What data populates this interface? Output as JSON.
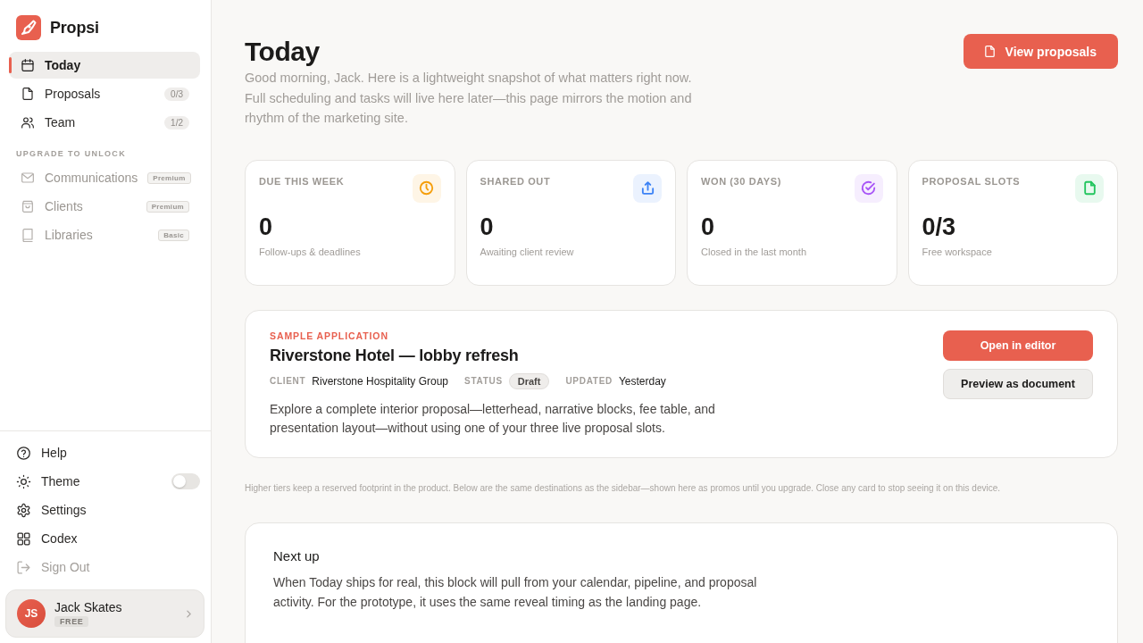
{
  "brand": {
    "name": "Propsi"
  },
  "sidebar": {
    "items": [
      {
        "label": "Today",
        "selected": true
      },
      {
        "label": "Proposals",
        "selected": false,
        "count": "0/3"
      },
      {
        "label": "Team",
        "selected": false,
        "count": "1/2"
      }
    ],
    "upgrade_section": {
      "title": "UPGRADE TO UNLOCK",
      "items": [
        {
          "label": "Communications",
          "badge": "Premium",
          "disabled": true
        },
        {
          "label": "Clients",
          "badge": "Premium",
          "disabled": true
        },
        {
          "label": "Libraries",
          "badge": "Basic",
          "disabled": true
        }
      ]
    },
    "footer_items": [
      {
        "label": "Help",
        "kind": "link"
      },
      {
        "label": "Theme",
        "kind": "toggle",
        "on": false
      },
      {
        "label": "Settings",
        "kind": "link"
      },
      {
        "label": "Codex",
        "kind": "link"
      },
      {
        "label": "Sign Out",
        "kind": "muted"
      }
    ],
    "user": {
      "initials": "JS",
      "name": "Jack Skates",
      "plan": "FREE"
    }
  },
  "header": {
    "title": "Today",
    "subtitle": "Good morning, Jack. Here is a lightweight snapshot of what matters right now. Full scheduling and tasks will live here later—this page mirrors the motion and rhythm of the marketing site.",
    "button": "View proposals"
  },
  "stats": [
    {
      "label": "DUE THIS WEEK",
      "value": "0",
      "caption": "Follow-ups & deadlines",
      "color": "#f59e0b"
    },
    {
      "label": "SHARED OUT",
      "value": "0",
      "caption": "Awaiting client review",
      "color": "#3b82f6"
    },
    {
      "label": "WON (30 DAYS)",
      "value": "0",
      "caption": "Closed in the last month",
      "color": "#a855f7"
    },
    {
      "label": "PROPOSAL SLOTS",
      "value": "0/3",
      "caption": "Free workspace",
      "color": "#22c55e"
    }
  ],
  "sample": {
    "eyebrow": "SAMPLE APPLICATION",
    "title": "Riverstone Hotel — lobby refresh",
    "meta": [
      {
        "label": "CLIENT",
        "value": "Riverstone Hospitality Group",
        "kind": "text"
      },
      {
        "label": "STATUS",
        "value": "Draft",
        "kind": "pill"
      },
      {
        "label": "UPDATED",
        "value": "Yesterday",
        "kind": "text"
      }
    ],
    "description": "Explore a complete interior proposal—letterhead, narrative blocks, fee table, and presentation layout—without using one of your three live proposal slots.",
    "primary_button": "Open in editor",
    "secondary_button": "Preview as document"
  },
  "footnote": "Higher tiers keep a reserved footprint in the product. Below are the same destinations as the sidebar—shown here as promos until you upgrade. Close any card to stop seeing it on this device.",
  "next_up": {
    "title": "Next up",
    "text": "When Today ships for real, this block will pull from your calendar, pipeline, and proposal activity. For the prototype, it uses the same reveal timing as the landing page."
  }
}
